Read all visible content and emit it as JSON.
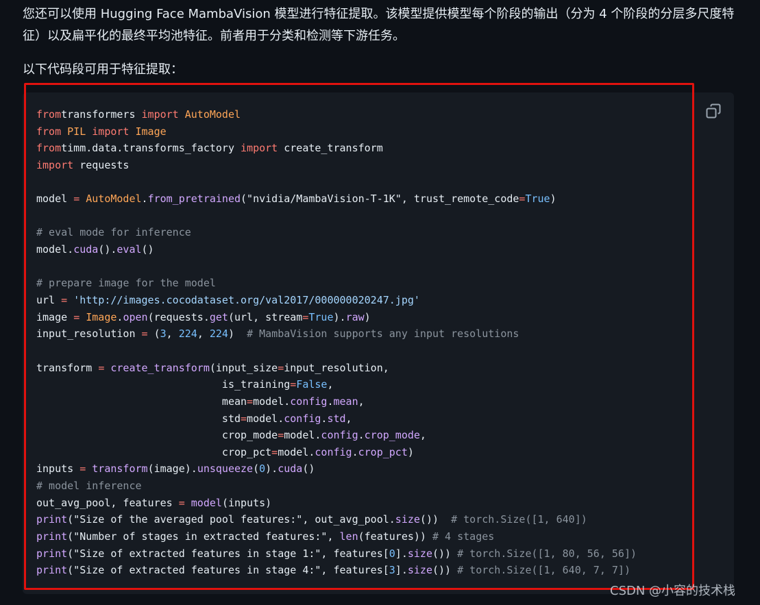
{
  "intro": {
    "paragraph1": "您还可以使用 Hugging Face MambaVision 模型进行特征提取。该模型提供模型每个阶段的输出（分为 4 个阶段的分层多尺度特征）以及扁平化的最终平均池特征。前者用于分类和检测等下游任务。",
    "paragraph2": "以下代码段可用于特征提取："
  },
  "code_block": {
    "copy_icon": "copy-icon",
    "lines": [
      [
        [
          "k",
          "from"
        ],
        [
          "",
          "transformers "
        ],
        [
          "k",
          "import"
        ],
        [
          "cls",
          " AutoModel"
        ]
      ],
      [
        [
          "k",
          "from"
        ],
        [
          "cls",
          " PIL "
        ],
        [
          "k",
          "import"
        ],
        [
          "cls",
          " Image"
        ]
      ],
      [
        [
          "k",
          "from"
        ],
        [
          "",
          "timm.data.transforms_factory "
        ],
        [
          "k",
          "import"
        ],
        [
          "",
          " create_transform"
        ]
      ],
      [
        [
          "k",
          "import"
        ],
        [
          "",
          " requests"
        ]
      ],
      [],
      [
        [
          "",
          "model "
        ],
        [
          "k",
          "="
        ],
        [
          "cls",
          " AutoModel"
        ],
        [
          "",
          "."
        ],
        [
          "fn",
          "from_pretrained"
        ],
        [
          "",
          "(\"nvidia/MambaVision-T-1K\", trust_remote_code"
        ],
        [
          "k",
          "="
        ],
        [
          "b",
          "True"
        ],
        [
          "",
          ")"
        ]
      ],
      [],
      [
        [
          "c",
          "# eval mode for inference"
        ]
      ],
      [
        [
          "",
          "model."
        ],
        [
          "fn",
          "cuda"
        ],
        [
          "",
          "()."
        ],
        [
          "fn",
          "eval"
        ],
        [
          "",
          "()"
        ]
      ],
      [],
      [
        [
          "c",
          "# prepare image for the model"
        ]
      ],
      [
        [
          "",
          "url "
        ],
        [
          "k",
          "="
        ],
        [
          "s",
          " 'http://images.cocodataset.org/val2017/000000020247.jpg'"
        ]
      ],
      [
        [
          "",
          "image "
        ],
        [
          "k",
          "="
        ],
        [
          "cls",
          " Image"
        ],
        [
          "",
          "."
        ],
        [
          "fn",
          "open"
        ],
        [
          "",
          "(requests."
        ],
        [
          "fn",
          "get"
        ],
        [
          "",
          "(url, stream"
        ],
        [
          "k",
          "="
        ],
        [
          "b",
          "True"
        ],
        [
          "",
          ")."
        ],
        [
          "fn",
          "raw"
        ],
        [
          "",
          ")"
        ]
      ],
      [
        [
          "",
          "input_resolution "
        ],
        [
          "k",
          "="
        ],
        [
          "",
          " ("
        ],
        [
          "n",
          "3"
        ],
        [
          "",
          ", "
        ],
        [
          "n",
          "224"
        ],
        [
          "",
          ", "
        ],
        [
          "n",
          "224"
        ],
        [
          "",
          ")  "
        ],
        [
          "c",
          "# MambaVision supports any input resolutions"
        ]
      ],
      [],
      [
        [
          "",
          "transform "
        ],
        [
          "k",
          "="
        ],
        [
          "fn",
          " create_transform"
        ],
        [
          "",
          "(input_size"
        ],
        [
          "k",
          "="
        ],
        [
          "",
          "input_resolution,"
        ]
      ],
      [
        [
          "",
          "                              is_training"
        ],
        [
          "k",
          "="
        ],
        [
          "b",
          "False"
        ],
        [
          "",
          ","
        ]
      ],
      [
        [
          "",
          "                              mean"
        ],
        [
          "k",
          "="
        ],
        [
          "",
          "model."
        ],
        [
          "fn",
          "config"
        ],
        [
          "",
          "."
        ],
        [
          "fn",
          "mean"
        ],
        [
          "",
          ","
        ]
      ],
      [
        [
          "",
          "                              std"
        ],
        [
          "k",
          "="
        ],
        [
          "",
          "model."
        ],
        [
          "fn",
          "config"
        ],
        [
          "",
          "."
        ],
        [
          "fn",
          "std"
        ],
        [
          "",
          ","
        ]
      ],
      [
        [
          "",
          "                              crop_mode"
        ],
        [
          "k",
          "="
        ],
        [
          "",
          "model."
        ],
        [
          "fn",
          "config"
        ],
        [
          "",
          "."
        ],
        [
          "fn",
          "crop_mode"
        ],
        [
          "",
          ","
        ]
      ],
      [
        [
          "",
          "                              crop_pct"
        ],
        [
          "k",
          "="
        ],
        [
          "",
          "model."
        ],
        [
          "fn",
          "config"
        ],
        [
          "",
          "."
        ],
        [
          "fn",
          "crop_pct"
        ],
        [
          "",
          ")"
        ]
      ],
      [
        [
          "",
          "inputs "
        ],
        [
          "k",
          "="
        ],
        [
          "fn",
          " transform"
        ],
        [
          "",
          "(image)."
        ],
        [
          "fn",
          "unsqueeze"
        ],
        [
          "",
          "("
        ],
        [
          "n",
          "0"
        ],
        [
          "",
          ")."
        ],
        [
          "fn",
          "cuda"
        ],
        [
          "",
          "()"
        ]
      ],
      [
        [
          "c",
          "# model inference"
        ]
      ],
      [
        [
          "",
          "out_avg_pool, features "
        ],
        [
          "k",
          "="
        ],
        [
          "fn",
          " model"
        ],
        [
          "",
          "(inputs)"
        ]
      ],
      [
        [
          "fn",
          "print"
        ],
        [
          "",
          "(\"Size of the averaged pool features:\", out_avg_pool."
        ],
        [
          "fn",
          "size"
        ],
        [
          "",
          "())  "
        ],
        [
          "c",
          "# torch.Size([1, 640])"
        ]
      ],
      [
        [
          "fn",
          "print"
        ],
        [
          "",
          "(\"Number of stages in extracted features:\", "
        ],
        [
          "fn",
          "len"
        ],
        [
          "",
          "(features)) "
        ],
        [
          "c",
          "# 4 stages"
        ]
      ],
      [
        [
          "fn",
          "print"
        ],
        [
          "",
          "(\"Size of extracted features in stage 1:\", features["
        ],
        [
          "n",
          "0"
        ],
        [
          "",
          "]."
        ],
        [
          "fn",
          "size"
        ],
        [
          "",
          "()) "
        ],
        [
          "c",
          "# torch.Size([1, 80, 56, 56])"
        ]
      ],
      [
        [
          "fn",
          "print"
        ],
        [
          "",
          "(\"Size of extracted features in stage 4:\", features["
        ],
        [
          "n",
          "3"
        ],
        [
          "",
          "]."
        ],
        [
          "fn",
          "size"
        ],
        [
          "",
          "()) "
        ],
        [
          "c",
          "# torch.Size([1, 640, 7, 7])"
        ]
      ]
    ]
  },
  "watermark": "CSDN @小容的技术栈",
  "colors": {
    "background": "#0d1117",
    "code_background": "#161b22",
    "highlight_border": "#e0120e",
    "keyword": "#ff7b72",
    "class_name": "#ffa657",
    "function": "#d2a8ff",
    "string": "#a5d6ff",
    "comment": "#8b949e",
    "builtin": "#79c0ff"
  }
}
